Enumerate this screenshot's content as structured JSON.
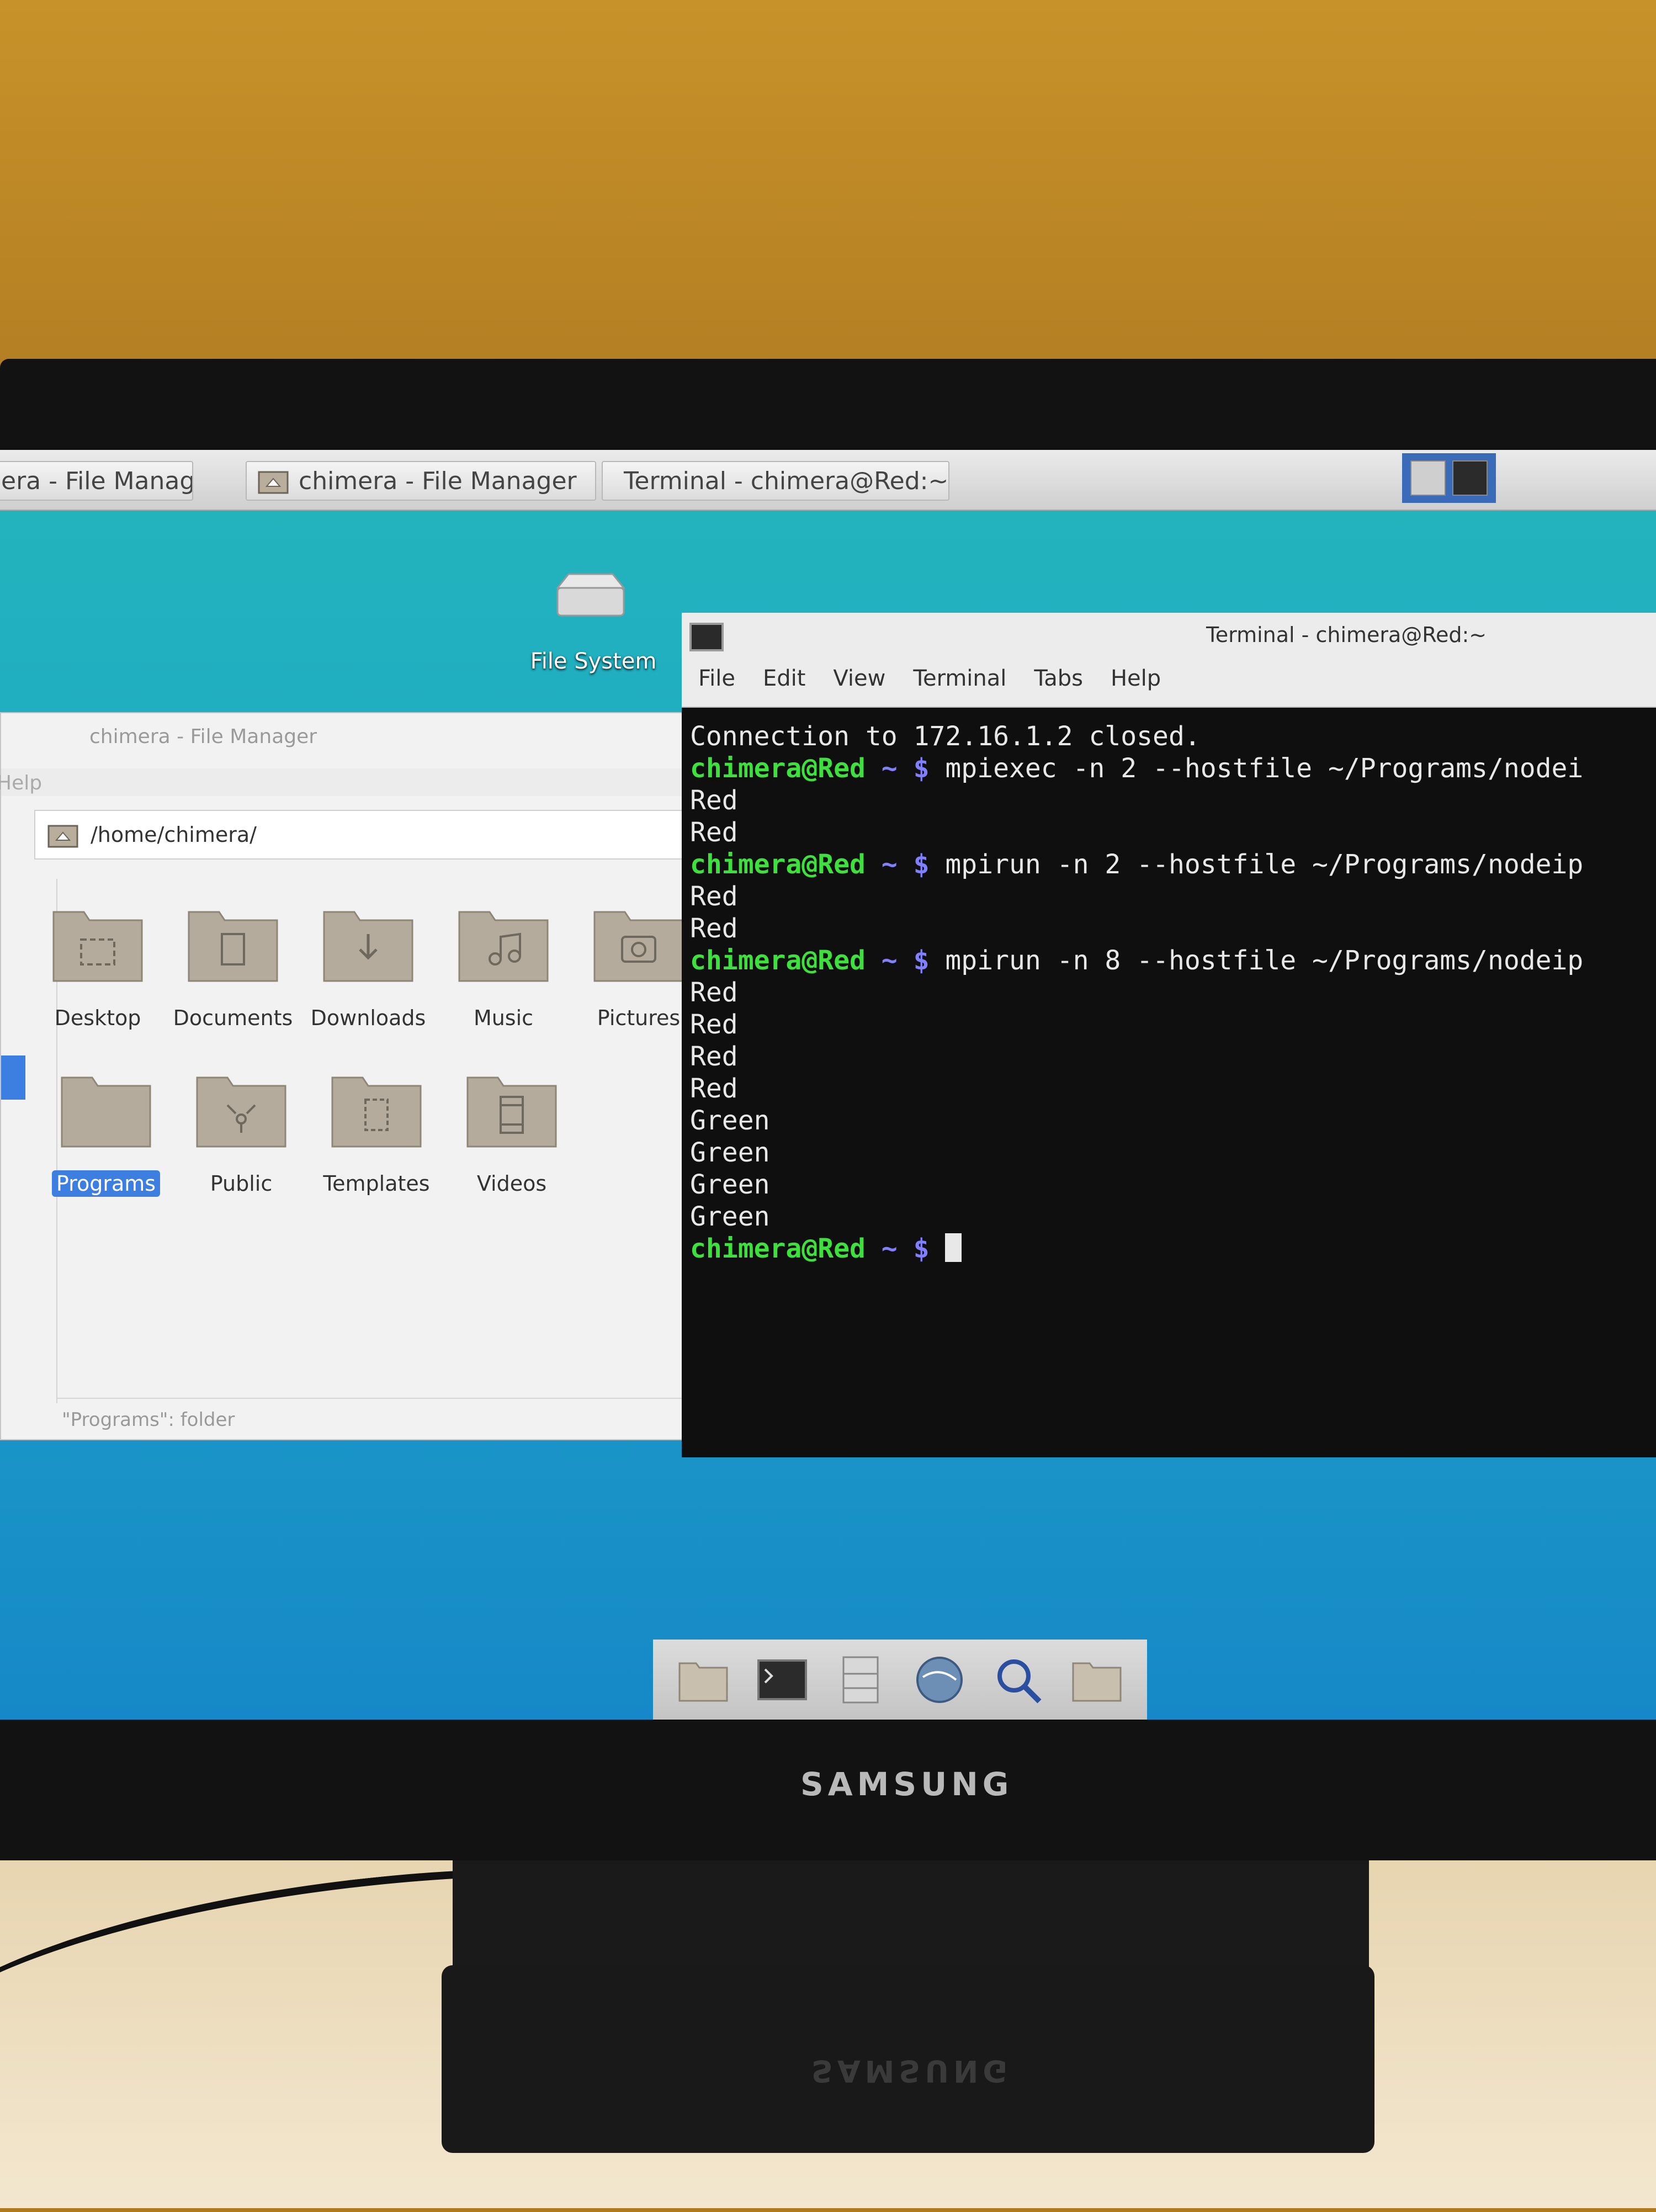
{
  "taskbar": {
    "tasks": [
      {
        "label": "era - File Manager]",
        "icon": "folder-icon"
      },
      {
        "label": "chimera - File Manager",
        "icon": "folder-home-icon"
      },
      {
        "label": "Terminal - chimera@Red:~",
        "icon": "terminal-icon"
      }
    ],
    "tray": [
      "folder-icon",
      "terminal-icon"
    ]
  },
  "desktop": {
    "filesystem_label": "File System"
  },
  "file_manager": {
    "title": "chimera - File Manager",
    "menu_partial": "Help",
    "path": "/home/chimera/",
    "items": [
      {
        "label": "Desktop",
        "icon": "desktop-folder-icon"
      },
      {
        "label": "Documents",
        "icon": "documents-folder-icon"
      },
      {
        "label": "Downloads",
        "icon": "downloads-folder-icon"
      },
      {
        "label": "Music",
        "icon": "music-folder-icon"
      },
      {
        "label": "Pictures",
        "icon": "pictures-folder-icon"
      },
      {
        "label": "Programs",
        "icon": "folder-icon",
        "selected": true
      },
      {
        "label": "Public",
        "icon": "public-folder-icon"
      },
      {
        "label": "Templates",
        "icon": "templates-folder-icon"
      },
      {
        "label": "Videos",
        "icon": "videos-folder-icon"
      }
    ],
    "status": "\"Programs\": folder"
  },
  "terminal": {
    "title": "Terminal - chimera@Red:~",
    "menu": [
      "File",
      "Edit",
      "View",
      "Terminal",
      "Tabs",
      "Help"
    ],
    "lines": [
      {
        "text": "Connection to 172.16.1.2 closed."
      },
      {
        "user": "chimera@Red",
        "tilde": " ~ $ ",
        "cmd": "mpiexec -n 2 --hostfile ~/Programs/nodei"
      },
      {
        "text": "Red"
      },
      {
        "text": "Red"
      },
      {
        "user": "chimera@Red",
        "tilde": " ~ $ ",
        "cmd": "mpirun -n 2 --hostfile ~/Programs/nodeip"
      },
      {
        "text": "Red"
      },
      {
        "text": "Red"
      },
      {
        "user": "chimera@Red",
        "tilde": " ~ $ ",
        "cmd": "mpirun -n 8 --hostfile ~/Programs/nodeip"
      },
      {
        "text": "Red"
      },
      {
        "text": "Red"
      },
      {
        "text": "Red"
      },
      {
        "text": "Red"
      },
      {
        "text": "Green"
      },
      {
        "text": "Green"
      },
      {
        "text": "Green"
      },
      {
        "text": "Green"
      },
      {
        "user": "chimera@Red",
        "tilde": " ~ $ ",
        "cursor": true
      }
    ]
  },
  "dock": [
    "folder-icon",
    "terminal-icon",
    "file-cabinet-icon",
    "web-browser-icon",
    "search-icon",
    "folder-icon"
  ],
  "monitor": {
    "brand": "SAMSUNG",
    "base_brand": "SAMSUNG"
  },
  "colors": {
    "prompt_user": "#3ee03e",
    "prompt_symbols": "#8080ff",
    "selection": "#3d7fe0",
    "desktop_top": "#22b5bc",
    "desktop_bottom": "#1688c7"
  }
}
